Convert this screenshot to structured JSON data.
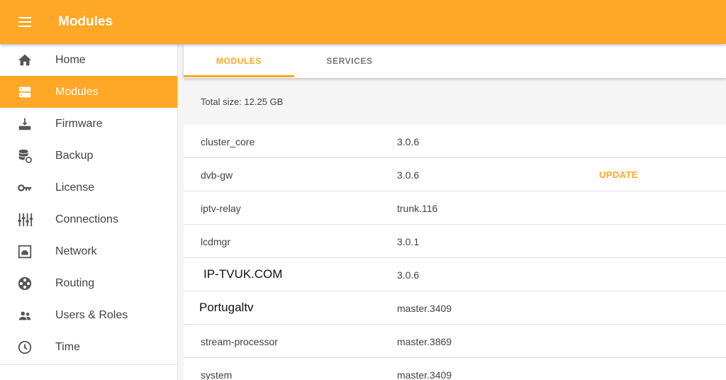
{
  "app": {
    "title": "Modules"
  },
  "sidebar": {
    "items": [
      {
        "label": "Home",
        "icon": "home-icon"
      },
      {
        "label": "Modules",
        "icon": "modules-icon",
        "active": true
      },
      {
        "label": "Firmware",
        "icon": "firmware-icon"
      },
      {
        "label": "Backup",
        "icon": "backup-icon"
      },
      {
        "label": "License",
        "icon": "key-icon"
      },
      {
        "label": "Connections",
        "icon": "connections-icon"
      },
      {
        "label": "Network",
        "icon": "network-icon"
      },
      {
        "label": "Routing",
        "icon": "routing-icon"
      },
      {
        "label": "Users & Roles",
        "icon": "users-icon"
      },
      {
        "label": "Time",
        "icon": "clock-icon"
      }
    ]
  },
  "tabs": [
    {
      "label": "MODULES",
      "active": true
    },
    {
      "label": "SERVICES",
      "active": false
    }
  ],
  "summary": {
    "total_size": "Total size: 12.25 GB"
  },
  "modules": [
    {
      "name": "cluster_core",
      "version": "3.0.6",
      "action": ""
    },
    {
      "name": "dvb-gw",
      "version": "3.0.6",
      "action": "UPDATE"
    },
    {
      "name": "iptv-relay",
      "version": "trunk.116",
      "action": ""
    },
    {
      "name": "lcdmgr",
      "version": "3.0.1",
      "action": ""
    },
    {
      "name": " IP-TVUK.COM",
      "version": "3.0.6",
      "action": ""
    },
    {
      "name": "Portugaltv",
      "version": "master.3409",
      "action": ""
    },
    {
      "name": "stream-processor",
      "version": "master.3869",
      "action": ""
    },
    {
      "name": "system",
      "version": "master.3409",
      "action": ""
    }
  ],
  "colors": {
    "accent": "#ffa726",
    "text": "#424242",
    "icon": "#555555"
  }
}
